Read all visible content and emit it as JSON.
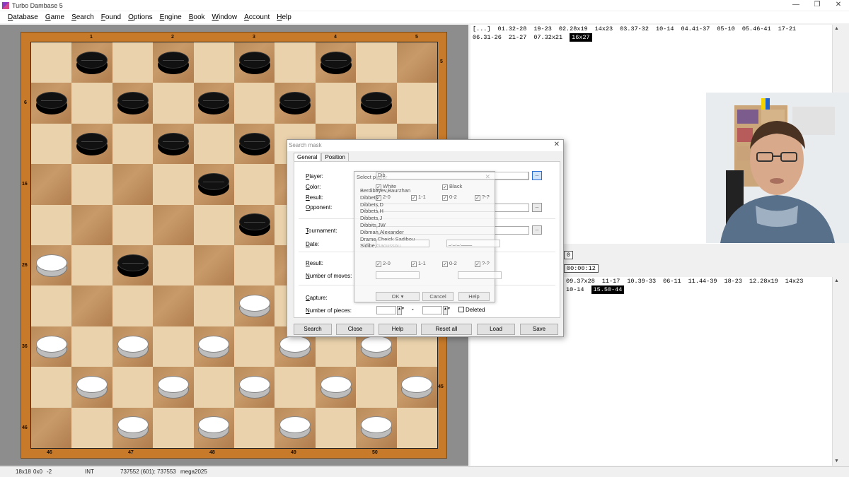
{
  "window": {
    "title": "Turbo Dambase 5",
    "minimize": "—",
    "restore": "❐",
    "close": "✕"
  },
  "menu": [
    "Database",
    "Game",
    "Search",
    "Found",
    "Options",
    "Engine",
    "Book",
    "Window",
    "Account",
    "Help"
  ],
  "board": {
    "top_coords": [
      "1",
      "2",
      "3",
      "4",
      "5"
    ],
    "bottom_coords": [
      "46",
      "47",
      "48",
      "49",
      "50"
    ],
    "left_coords": [
      "6",
      "16",
      "26",
      "36",
      "46"
    ],
    "right_coords": [
      "5",
      "45"
    ],
    "colors": {
      "light": "#ead2ac",
      "dark": "#b98a5a",
      "frame": "#c77a2a"
    },
    "pieces": [
      {
        "color": "black",
        "row": 0,
        "col": 1
      },
      {
        "color": "black",
        "row": 0,
        "col": 3
      },
      {
        "color": "black",
        "row": 0,
        "col": 5
      },
      {
        "color": "black",
        "row": 0,
        "col": 7
      },
      {
        "color": "black",
        "row": 1,
        "col": 0
      },
      {
        "color": "black",
        "row": 1,
        "col": 2
      },
      {
        "color": "black",
        "row": 1,
        "col": 4
      },
      {
        "color": "black",
        "row": 1,
        "col": 6
      },
      {
        "color": "black",
        "row": 1,
        "col": 8
      },
      {
        "color": "black",
        "row": 2,
        "col": 1
      },
      {
        "color": "black",
        "row": 2,
        "col": 3
      },
      {
        "color": "black",
        "row": 2,
        "col": 5
      },
      {
        "color": "black",
        "row": 3,
        "col": 4
      },
      {
        "color": "black",
        "row": 4,
        "col": 5
      },
      {
        "color": "white",
        "row": 5,
        "col": 0
      },
      {
        "color": "black",
        "row": 5,
        "col": 2
      },
      {
        "color": "white",
        "row": 6,
        "col": 5
      },
      {
        "color": "white",
        "row": 7,
        "col": 0
      },
      {
        "color": "white",
        "row": 7,
        "col": 2
      },
      {
        "color": "white",
        "row": 7,
        "col": 4
      },
      {
        "color": "white",
        "row": 7,
        "col": 6
      },
      {
        "color": "white",
        "row": 7,
        "col": 8
      },
      {
        "color": "white",
        "row": 8,
        "col": 1
      },
      {
        "color": "white",
        "row": 8,
        "col": 3
      },
      {
        "color": "white",
        "row": 8,
        "col": 5
      },
      {
        "color": "white",
        "row": 8,
        "col": 7
      },
      {
        "color": "white",
        "row": 8,
        "col": 9
      },
      {
        "color": "white",
        "row": 9,
        "col": 2
      },
      {
        "color": "white",
        "row": 9,
        "col": 4
      },
      {
        "color": "white",
        "row": 9,
        "col": 6
      },
      {
        "color": "white",
        "row": 9,
        "col": 8
      }
    ]
  },
  "notation_top": {
    "lines": [
      [
        "[...]",
        "01.32-28",
        "19-23",
        "02.28x19",
        "14x23",
        "03.37-32",
        "10-14",
        "04.41-37",
        "05-10",
        "05.46-41",
        "17-21"
      ],
      [
        "06.31-26",
        "21-27",
        "07.32x21",
        "16x27"
      ]
    ],
    "current": "16x27"
  },
  "notation_bottom": {
    "lines": [
      [
        "09.37x28",
        "11-17",
        "10.39-33",
        "06-11",
        "11.44-39",
        "18-23",
        "12.28x19",
        "14x23"
      ],
      [
        "10-14",
        "15.50-44"
      ]
    ],
    "current": "15.50-44"
  },
  "clocks": [
    "0",
    "00:00:12"
  ],
  "status": {
    "coords": "18x18",
    "offset": "0x0",
    "value": "-2",
    "mode": "INT",
    "games": "737552 (601): 737553",
    "db": "mega2025"
  },
  "search_dialog": {
    "title": "Search mask",
    "tabs": [
      "General",
      "Position"
    ],
    "labels": {
      "player": "Player:",
      "color": "Color:",
      "result": "Result:",
      "opponent": "Opponent:",
      "tournament": "Tournament:",
      "date": "Date:",
      "result2": "Result:",
      "moves": "Number of moves:",
      "capture": "Capture:",
      "pieces": "Number of pieces:",
      "deleted": "Deleted"
    },
    "dots": "..",
    "dash": "-",
    "buttons": [
      "Search",
      "Close",
      "Help",
      "Reset all",
      "Load",
      "Save"
    ]
  },
  "select_player": {
    "title": "Select player",
    "input_value": "Dib",
    "white_label": "White",
    "black_label": "Black",
    "results_row1": [
      "2-0",
      "1-1",
      "0-2",
      "?-?"
    ],
    "results_row2": [
      "2-0",
      "1-1",
      "0-2",
      "?-?"
    ],
    "players": [
      "Berdibayev,Baurzhan",
      "Dibbets",
      "Dibbets,D",
      "Dibbets,H",
      "Dibbets,J",
      "Dibbits,JW",
      "Dibman,Alexander",
      "Drame,Cheick Sadibou",
      "Sidibe,Gaoussou"
    ],
    "date_placeholder": "_._._.____",
    "buttons": {
      "ok": "OK",
      "cancel": "Cancel",
      "help": "Help"
    }
  }
}
